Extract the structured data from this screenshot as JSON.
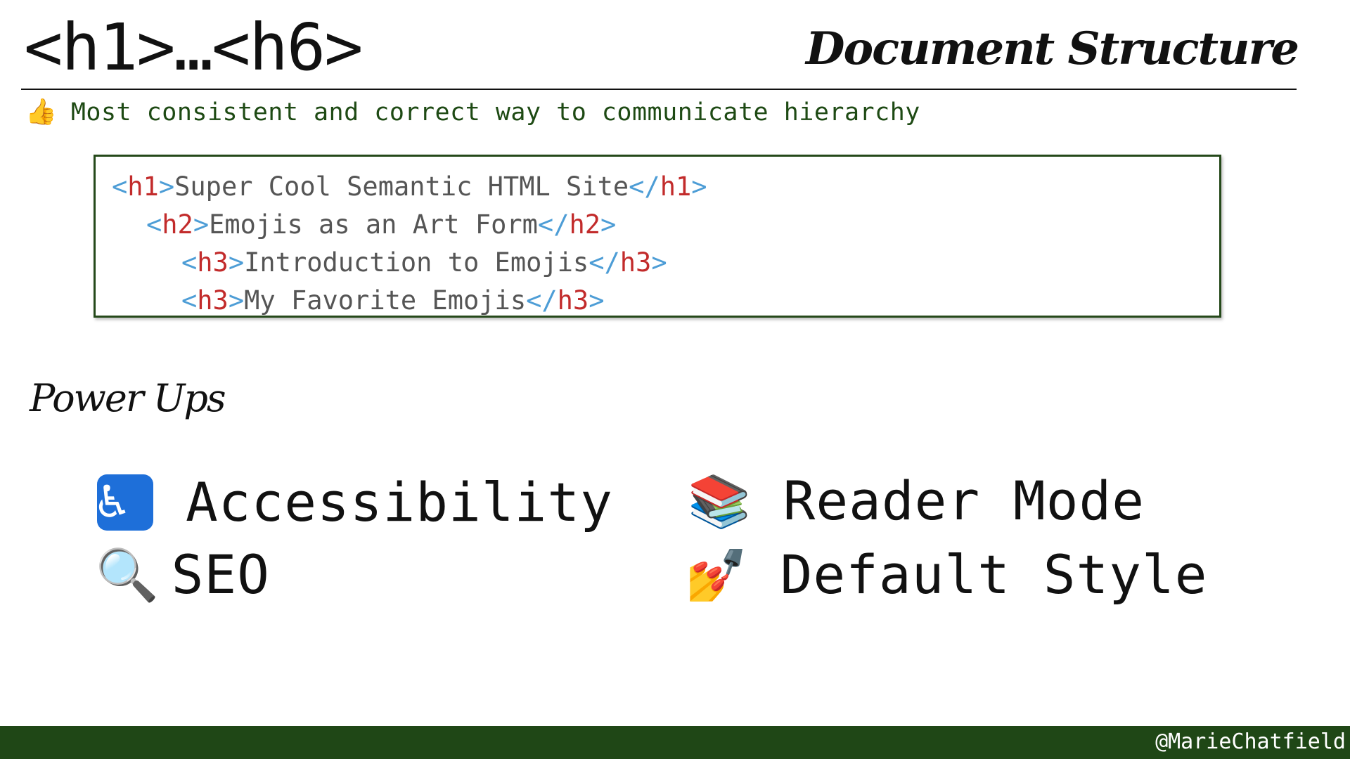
{
  "slide": {
    "title": "<h1>…<h6>",
    "section": "Document Structure",
    "tagline": {
      "icon": "thumbs-up-icon",
      "icon_glyph": "👍",
      "text": "Most consistent and correct way to communicate hierarchy"
    },
    "code_example": {
      "lines": [
        {
          "tag": "h1",
          "text": "Super Cool Semantic HTML Site",
          "indent": 0
        },
        {
          "tag": "h2",
          "text": "Emojis as an Art Form",
          "indent": 1
        },
        {
          "tag": "h3",
          "text": "Introduction to Emojis",
          "indent": 2
        },
        {
          "tag": "h3",
          "text": "My Favorite Emojis",
          "indent": 2
        }
      ],
      "open_bracket": "<",
      "close_bracket": ">",
      "end_open": "</"
    },
    "power_ups": {
      "heading": "Power Ups",
      "items": [
        {
          "label": "Accessibility",
          "icon": "wheelchair-icon",
          "glyph": "♿"
        },
        {
          "label": "Reader Mode",
          "icon": "books-icon",
          "glyph": "📚"
        },
        {
          "label": "SEO",
          "icon": "magnifying-glass-icon",
          "glyph": "🔍"
        },
        {
          "label": "Default Style",
          "icon": "nail-polish-icon",
          "glyph": "💅"
        }
      ]
    },
    "footer": {
      "handle": "@MarieChatfield"
    },
    "colors": {
      "accent_green": "#1f4716",
      "tagline_green": "#1e4a14",
      "code_tag": "#c22b2b",
      "code_punct": "#4d9dd6",
      "code_text": "#555555"
    }
  }
}
